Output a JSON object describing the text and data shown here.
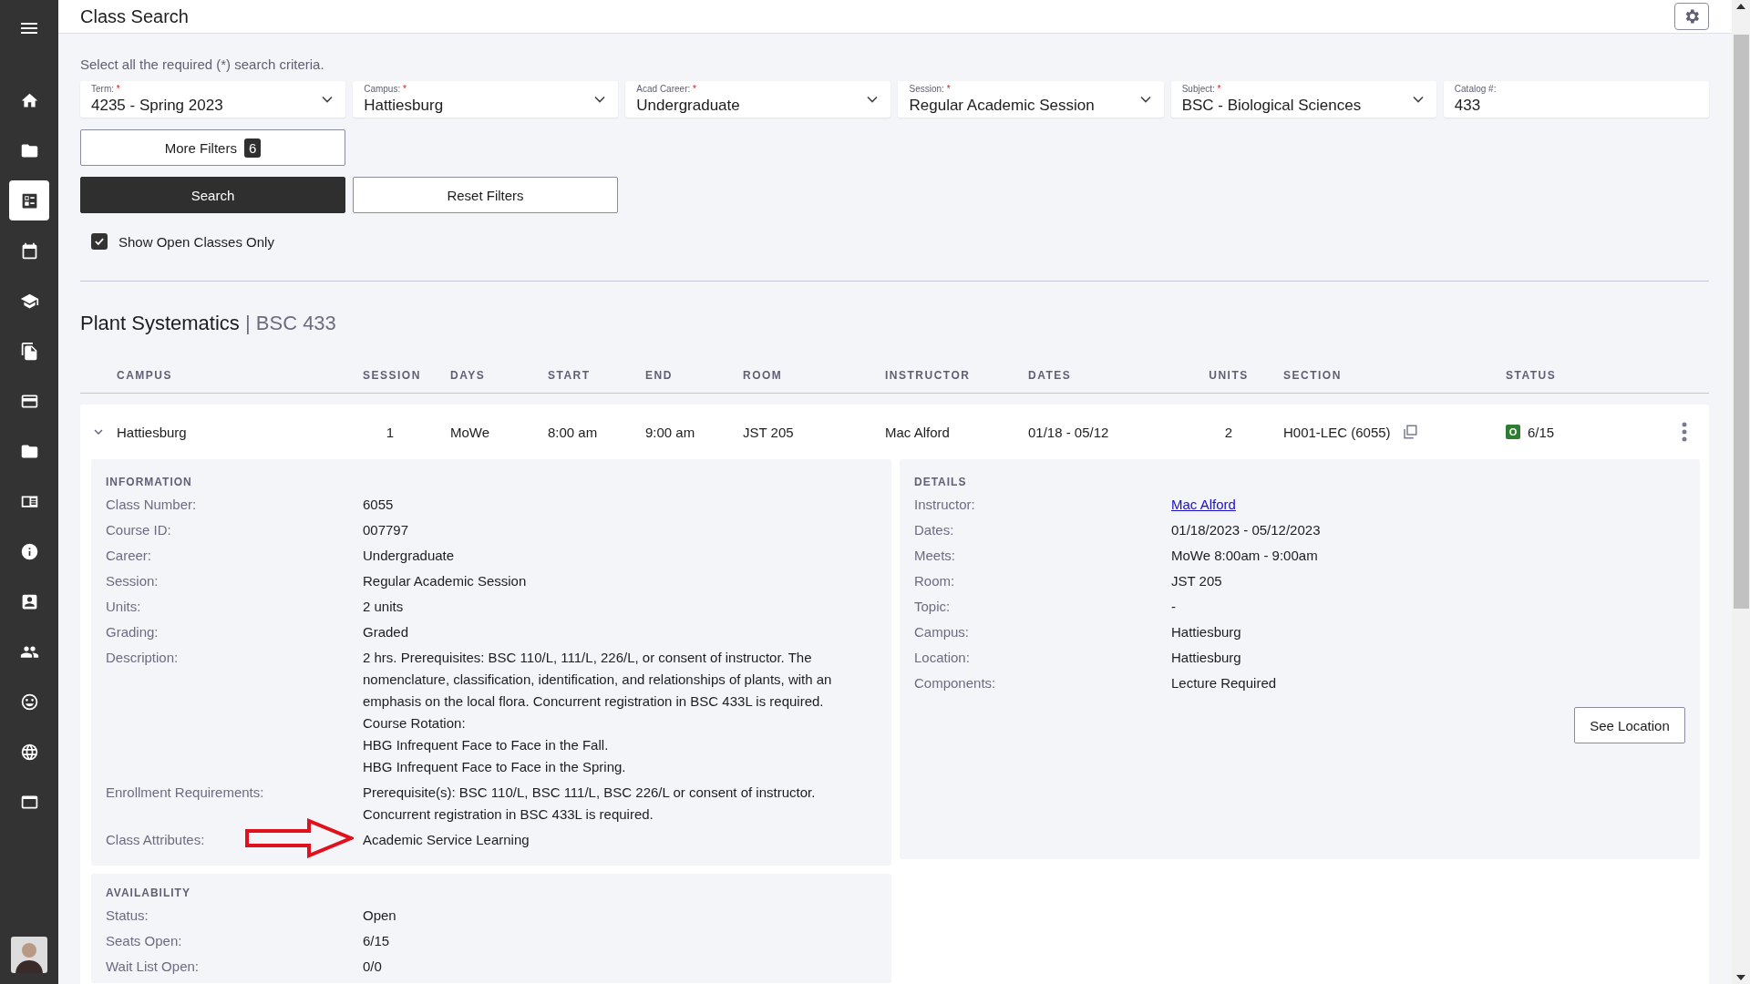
{
  "header": {
    "title": "Class Search"
  },
  "sidebar": {
    "items": [
      {
        "selected": false
      },
      {
        "selected": false
      },
      {
        "selected": true
      },
      {
        "selected": false
      },
      {
        "selected": false
      },
      {
        "selected": false
      },
      {
        "selected": false
      },
      {
        "selected": false
      },
      {
        "selected": false
      },
      {
        "selected": false
      },
      {
        "selected": false
      },
      {
        "selected": false
      },
      {
        "selected": false
      },
      {
        "selected": false
      },
      {
        "selected": false
      }
    ]
  },
  "instructions": "Select all the required (*) search criteria.",
  "filters": [
    {
      "kind": "select",
      "label": "Term:",
      "required_mark": "*",
      "value": "4235 - Spring 2023"
    },
    {
      "kind": "select",
      "label": "Campus:",
      "required_mark": "*",
      "value": "Hattiesburg"
    },
    {
      "kind": "select",
      "label": "Acad Career:",
      "required_mark": "*",
      "value": "Undergraduate"
    },
    {
      "kind": "select",
      "label": "Session:",
      "required_mark": "*",
      "value": "Regular Academic Session"
    },
    {
      "kind": "select",
      "label": "Subject:",
      "required_mark": "*",
      "value": "BSC - Biological Sciences"
    },
    {
      "kind": "text",
      "label": "Catalog #:",
      "value": "433"
    }
  ],
  "more_filters": {
    "label": "More Filters",
    "count": "6"
  },
  "buttons": {
    "search": "Search",
    "reset": "Reset Filters"
  },
  "open_only": {
    "label": "Show Open Classes Only",
    "checked": true
  },
  "course": {
    "title": "Plant Systematics",
    "separator": "|",
    "code": "BSC 433"
  },
  "table": {
    "columns": [
      "CAMPUS",
      "SESSION",
      "DAYS",
      "START",
      "END",
      "ROOM",
      "INSTRUCTOR",
      "DATES",
      "UNITS",
      "SECTION",
      "STATUS"
    ],
    "rows": [
      {
        "expanded": true,
        "campus": "Hattiesburg",
        "session": "1",
        "days": "MoWe",
        "start": "8:00 am",
        "end": "9:00 am",
        "room": "JST 205",
        "instructor": "Mac Alford",
        "dates": "01/18 - 05/12",
        "units": "2",
        "section": "H001-LEC (6055)",
        "status_mark": "O",
        "seats": "6/15"
      }
    ]
  },
  "information": {
    "heading": "INFORMATION",
    "rows": [
      {
        "label": "Class Number:",
        "lines": [
          "6055"
        ]
      },
      {
        "label": "Course ID:",
        "lines": [
          "007797"
        ]
      },
      {
        "label": "Career:",
        "lines": [
          "Undergraduate"
        ]
      },
      {
        "label": "Session:",
        "lines": [
          "Regular Academic Session"
        ]
      },
      {
        "label": "Units:",
        "lines": [
          "2 units"
        ]
      },
      {
        "label": "Grading:",
        "lines": [
          "Graded"
        ]
      },
      {
        "label": "Description:",
        "lines": [
          "2 hrs. Prerequisites: BSC 110/L, 111/L, 226/L, or consent of instructor. The nomenclature, classification, identification, and relationships of plants, with an emphasis on the local flora. Concurrent registration in BSC 433L is required.",
          "Course Rotation:",
          "HBG Infrequent Face to Face in the Fall.",
          "HBG Infrequent Face to Face in the Spring."
        ]
      },
      {
        "label": "Enrollment Requirements:",
        "lines": [
          "Prerequisite(s): BSC 110/L, BSC 111/L, BSC 226/L or consent of instructor.",
          "Concurrent registration in BSC 433L is required."
        ]
      },
      {
        "label": "Class Attributes:",
        "lines": [
          "Academic Service Learning"
        ],
        "annotated": true
      }
    ]
  },
  "details": {
    "heading": "DETAILS",
    "rows": [
      {
        "label": "Instructor:",
        "value": "Mac Alford",
        "kind": "link"
      },
      {
        "label": "Dates:",
        "value": "01/18/2023 - 05/12/2023",
        "kind": "text"
      },
      {
        "label": "Meets:",
        "value": "MoWe 8:00am - 9:00am",
        "kind": "text"
      },
      {
        "label": "Room:",
        "value": "JST 205",
        "kind": "text"
      },
      {
        "label": "Topic:",
        "value": "-",
        "kind": "text"
      },
      {
        "label": "Campus:",
        "value": "Hattiesburg",
        "kind": "text"
      },
      {
        "label": "Location:",
        "value": "Hattiesburg",
        "kind": "text"
      },
      {
        "label": "Components:",
        "value": "Lecture Required",
        "kind": "text"
      }
    ],
    "button": "See Location"
  },
  "availability": {
    "heading": "AVAILABILITY",
    "rows": [
      {
        "label": "Status:",
        "value": "Open"
      },
      {
        "label": "Seats Open:",
        "value": "6/15"
      },
      {
        "label": "Wait List Open:",
        "value": "0/0"
      }
    ]
  }
}
